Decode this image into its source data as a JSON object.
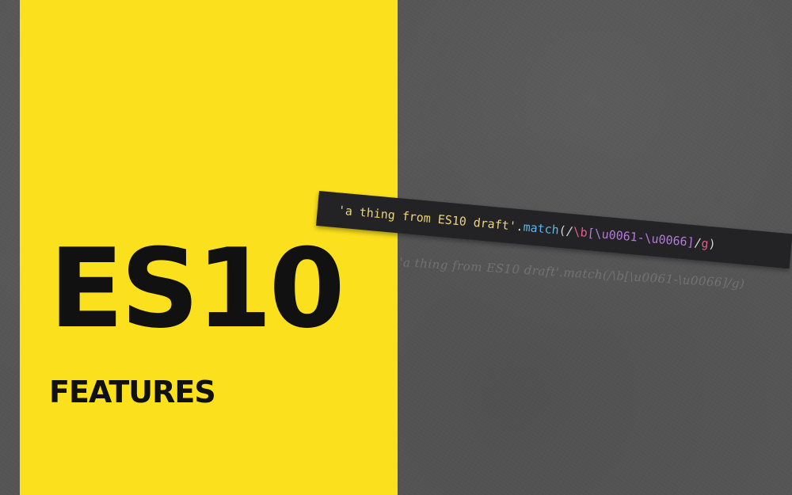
{
  "title": "ES10",
  "subtitle": "FEATURES",
  "code": {
    "string": "'a thing from ES10 draft'",
    "dot": ".",
    "method": "match",
    "open": "(/",
    "escape": "\\b",
    "regex_class": "[\\u0061-\\u0066]",
    "slash": "/",
    "flag": "g",
    "close": ")"
  },
  "ghost_text": "'a thing from ES10 draft'.match(/\\b[\\u0061-\\u0066]/g)",
  "colors": {
    "yellow": "#fae01d",
    "background": "#555555",
    "code_background": "#232325"
  }
}
